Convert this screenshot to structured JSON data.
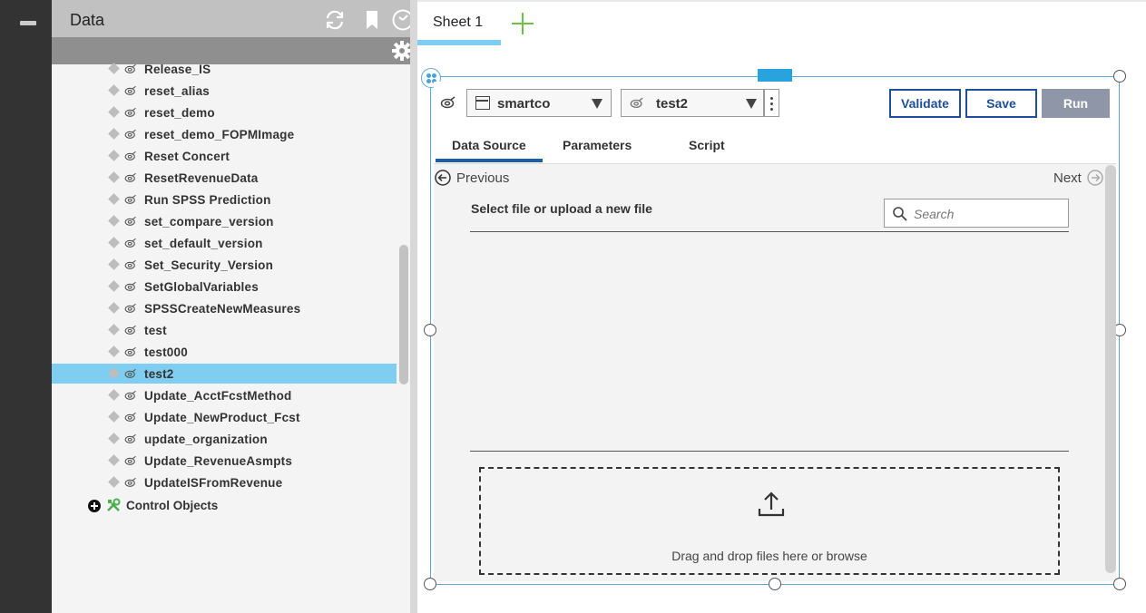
{
  "panel": {
    "title": "Data",
    "items": [
      {
        "label": "Release_IS"
      },
      {
        "label": "reset_alias"
      },
      {
        "label": "reset_demo"
      },
      {
        "label": "reset_demo_FOPMImage"
      },
      {
        "label": "Reset Concert"
      },
      {
        "label": "ResetRevenueData"
      },
      {
        "label": "Run SPSS Prediction"
      },
      {
        "label": "set_compare_version"
      },
      {
        "label": "set_default_version"
      },
      {
        "label": "Set_Security_Version"
      },
      {
        "label": "SetGlobalVariables"
      },
      {
        "label": "SPSSCreateNewMeasures"
      },
      {
        "label": "test"
      },
      {
        "label": "test000"
      },
      {
        "label": "test2",
        "selected": true
      },
      {
        "label": "Update_AcctFcstMethod"
      },
      {
        "label": "Update_NewProduct_Fcst"
      },
      {
        "label": "update_organization"
      },
      {
        "label": "Update_RevenueAsmpts"
      },
      {
        "label": "UpdateISFromRevenue"
      }
    ],
    "control_objects_label": "Control Objects"
  },
  "sheet": {
    "tab_label": "Sheet 1"
  },
  "widget": {
    "server_select": "smartco",
    "process_select": "test2",
    "buttons": {
      "validate": "Validate",
      "save": "Save",
      "run": "Run"
    },
    "tabs": [
      "Data Source",
      "Parameters",
      "Script"
    ],
    "active_tab": "Data Source",
    "nav": {
      "previous": "Previous",
      "next": "Next"
    },
    "select_file_label": "Select file or upload a new file",
    "search_placeholder": "Search",
    "dropzone_text": "Drag and drop files here or browse"
  },
  "colors": {
    "selected_row": "#7fcdf1",
    "primary": "#1c4f9c",
    "run_disabled": "#8e96a8",
    "add_sheet": "#6cc04a",
    "frame_border": "#5aa9d6"
  },
  "icons": {
    "refresh": "refresh-icon",
    "bookmark": "bookmark-icon",
    "clock": "clock-icon",
    "gear": "gear-icon",
    "process": "process-icon",
    "upload": "upload-icon",
    "search": "search-icon"
  }
}
